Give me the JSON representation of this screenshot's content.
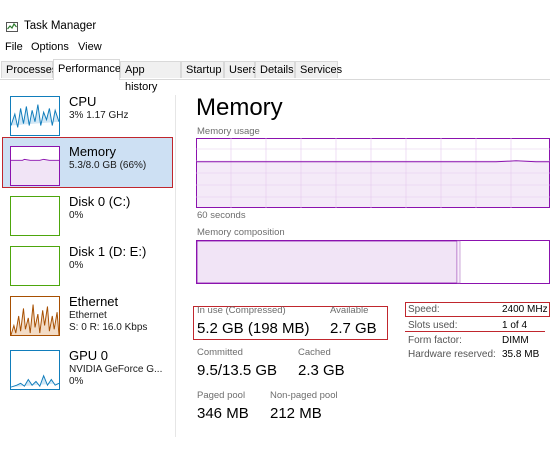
{
  "window": {
    "title": "Task Manager"
  },
  "menu": [
    "File",
    "Options",
    "View"
  ],
  "tabs": [
    "Processes",
    "Performance",
    "App history",
    "Startup",
    "Users",
    "Details",
    "Services"
  ],
  "active_tab": "Performance",
  "sidebar": {
    "items": [
      {
        "name": "CPU",
        "sub1": "3% 1.17 GHz",
        "sub2": "",
        "sub3": "",
        "color": "#117dbb"
      },
      {
        "name": "Memory",
        "sub1": "5.3/8.0 GB (66%)",
        "sub2": "",
        "sub3": "",
        "color": "#8b12ae"
      },
      {
        "name": "Disk 0 (C:)",
        "sub1": "0%",
        "sub2": "",
        "sub3": "",
        "color": "#4da60c"
      },
      {
        "name": "Disk 1 (D: E:)",
        "sub1": "0%",
        "sub2": "",
        "sub3": "",
        "color": "#4da60c"
      },
      {
        "name": "Ethernet",
        "sub1": "Ethernet",
        "sub2": "S: 0 R: 16.0 Kbps",
        "sub3": "",
        "color": "#a74f01"
      },
      {
        "name": "GPU 0",
        "sub1": "NVIDIA GeForce G...",
        "sub2": "0%",
        "sub3": "",
        "color": "#117dbb"
      }
    ]
  },
  "main": {
    "title": "Memory",
    "usage_label": "Memory usage",
    "time_label": "60 seconds",
    "composition_label": "Memory composition",
    "stats": {
      "in_use_label": "In use (Compressed)",
      "in_use_value": "5.2 GB (198 MB)",
      "available_label": "Available",
      "available_value": "2.7 GB",
      "committed_label": "Committed",
      "committed_value": "9.5/13.5 GB",
      "cached_label": "Cached",
      "cached_value": "2.3 GB",
      "paged_label": "Paged pool",
      "paged_value": "346 MB",
      "nonpaged_label": "Non-paged pool",
      "nonpaged_value": "212 MB"
    },
    "specs": {
      "speed_label": "Speed:",
      "speed_value": "2400 MHz",
      "slots_label": "Slots used:",
      "slots_value": "1 of 4",
      "form_label": "Form factor:",
      "form_value": "DIMM",
      "hw_label": "Hardware reserved:",
      "hw_value": "35.8 MB"
    },
    "usage_fraction": 0.66
  },
  "colors": {
    "memory": "#8b12ae",
    "highlight": "#c0262d"
  }
}
